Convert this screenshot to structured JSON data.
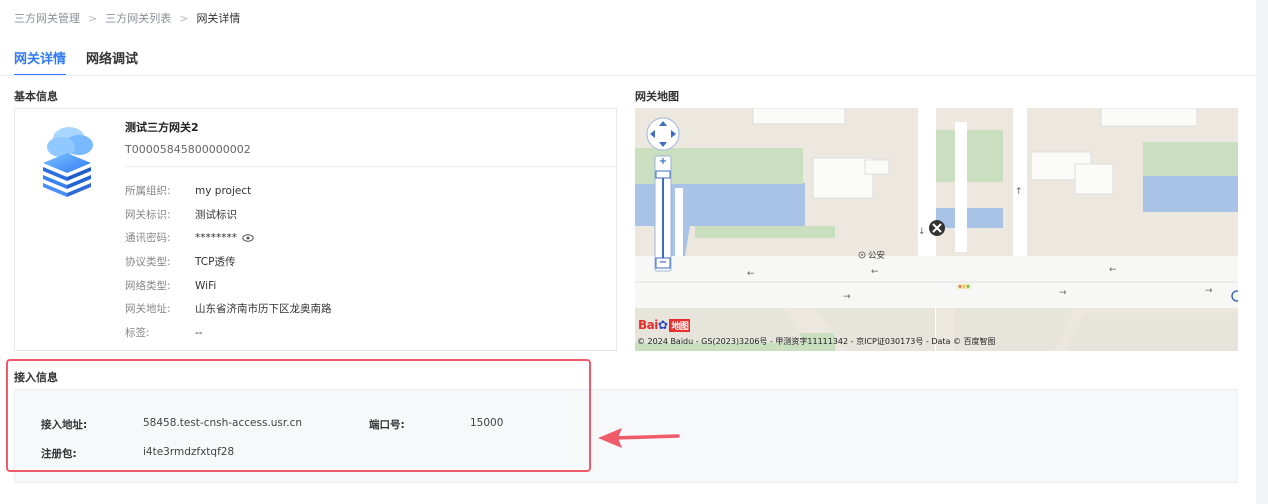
{
  "breadcrumb": {
    "items": [
      "三方网关管理",
      "三方网关列表"
    ],
    "current": "网关详情",
    "separator": ">"
  },
  "tabs": [
    {
      "label": "网关详情",
      "active": true
    },
    {
      "label": "网络调试",
      "active": false
    }
  ],
  "basic": {
    "title": "基本信息",
    "name": "测试三方网关2",
    "id": "T00005845800000002",
    "fields": [
      {
        "label": "所属组织:",
        "value": "my project"
      },
      {
        "label": "网关标识:",
        "value": "测试标识"
      },
      {
        "label": "通讯密码:",
        "value": "********"
      },
      {
        "label": "协议类型:",
        "value": "TCP透传"
      },
      {
        "label": "网络类型:",
        "value": "WiFi"
      },
      {
        "label": "网关地址:",
        "value": "山东省济南市历下区龙奥南路"
      },
      {
        "label": "标签:",
        "value": "--"
      }
    ]
  },
  "map": {
    "title": "网关地图",
    "poi": "公安",
    "logo_text": "Bai",
    "logo_ditu": "地图",
    "zoom_in": "+",
    "zoom_out": "−",
    "copyright": "© 2024 Baidu - GS(2023)3206号 - 甲测资字11111342 - 京ICP证030173号 - Data © 百度智图"
  },
  "access": {
    "title": "接入信息",
    "address_label": "接入地址:",
    "address_value": "58458.test-cnsh-access.usr.cn",
    "port_label": "端口号:",
    "port_value": "15000",
    "reg_label": "注册包:",
    "reg_value": "i4te3rmdzfxtqf28"
  },
  "colors": {
    "accent": "#2f7af5",
    "highlight": "#ef5b69"
  }
}
